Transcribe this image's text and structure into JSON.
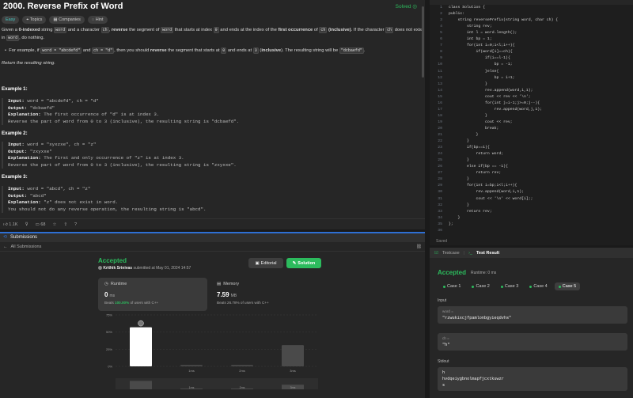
{
  "problem": {
    "title": "2000. Reverse Prefix of Word",
    "status": "Solved",
    "tags": [
      "Easy",
      "Topics",
      "Companies",
      "Hint"
    ],
    "desc_line1": [
      "Given a ",
      "0-indexed",
      " string ",
      "word",
      " and a character ",
      "ch",
      ", ",
      "reverse",
      " the segment of ",
      "word",
      " that starts at index ",
      "0",
      " and ends at the index of the ",
      "first occurrence",
      " of ",
      "ch",
      " (inclusive)",
      ". If the character ",
      "ch",
      " does not exist"
    ],
    "desc_line2": [
      "in ",
      "word",
      ", do nothing."
    ],
    "bullet": [
      "For example, if ",
      "word = \"abcdefd\"",
      " and ",
      "ch = \"d\"",
      ", then you should ",
      "reverse",
      " the segment that starts at ",
      "0",
      " and ends at ",
      "3",
      " (",
      "inclusive",
      "). The resulting string will be ",
      "\"dcbaefd\"",
      "."
    ],
    "return_text": "Return the resulting string.",
    "examples": [
      {
        "title": "Example 1:",
        "input": "word = \"abcdefd\", ch = \"d\"",
        "output": "\"dcbaefd\"",
        "explanation": [
          "The first occurrence of \"d\" is at index 3.",
          "Reverse the part of word from 0 to 3 (inclusive), the resulting string is \"dcbaefd\"."
        ]
      },
      {
        "title": "Example 2:",
        "input": "word = \"xyxzxe\", ch = \"z\"",
        "output": "\"zxyxxe\"",
        "explanation": [
          "The first and only occurrence of \"z\" is at index 3.",
          "Reverse the part of word from 0 to 3 (inclusive), the resulting string is \"zxyxxe\"."
        ]
      },
      {
        "title": "Example 3:",
        "input": "word = \"abcd\", ch = \"z\"",
        "output": "\"abcd\"",
        "explanation": [
          "\"z\" does not exist in word.",
          "You should not do any reverse operation, the resulting string is \"abcd\"."
        ]
      }
    ],
    "labels": {
      "input": "Input:",
      "output": "Output:",
      "explanation": "Explanation:"
    },
    "footer": {
      "likes": "1.1K",
      "comments": "68"
    }
  },
  "submissions": {
    "header_title": "Submissions",
    "sub_header": "All Submissions",
    "result": "Accepted",
    "author": "Krithik Srinivas",
    "submitted_text": "submitted at May 01, 2024 14:57",
    "editorial_label": "Editorial",
    "solution_label": "Solution",
    "runtime": {
      "label": "Runtime",
      "value": "0",
      "unit": "ms",
      "beats_prefix": "Beats",
      "beats_value": "100.00%",
      "beats_suffix": "of users with C++"
    },
    "memory": {
      "label": "Memory",
      "value": "7.59",
      "unit": "MB",
      "beats_prefix": "Beats",
      "beats_value": "26.78%",
      "beats_suffix": "of users with C++"
    }
  },
  "chart_data": {
    "type": "bar",
    "categories": [
      "0ms",
      "1ms",
      "2ms",
      "3ms"
    ],
    "values": [
      57,
      2,
      2,
      31
    ],
    "highlight_index": 0,
    "ylim": [
      0,
      75
    ],
    "yticks": [
      "0%",
      "25%",
      "50%",
      "75%"
    ],
    "x_tick_labels": [
      "1ms",
      "2ms",
      "3ms"
    ],
    "mini_tick_labels": [
      "1ms",
      "2ms",
      "3ms"
    ]
  },
  "editor": {
    "lines": [
      "class Solution {",
      "public:",
      "    string reversePrefix(string word, char ch) {",
      "        string rev;",
      "        int l = word.length();",
      "        int bp = 1;",
      "        for(int i=0;i<l;i++){",
      "            if(word[i]==ch){",
      "                if(i==l-1){",
      "                    bp = -1;",
      "                }else{",
      "                    bp = i+1;",
      "                }",
      "                rev.append(word,i,1);",
      "                cout << rev << '\\n';",
      "                for(int j=i-1;j>=0;j--){",
      "                    rev.append(word,j,1);",
      "                }",
      "                cout << rev;",
      "                break;",
      "            }",
      "        }",
      "        if(bp==1){",
      "            return word;",
      "        }",
      "        else if(bp == -1){",
      "            return rev;",
      "        }",
      "        for(int i=bp;i<l;i++){",
      "            rev.append(word,i,1);",
      "            cout << '\\n' << word[i];;",
      "        }",
      "        return rev;",
      "    }",
      "};",
      ""
    ],
    "status": "Saved"
  },
  "testcase": {
    "tab_testcase": "Testcase",
    "tab_result": "Test Result",
    "result": "Accepted",
    "runtime_text": "Runtime: 0 ms",
    "cases": [
      "Case 1",
      "Case 2",
      "Case 3",
      "Case 4",
      "Case 5"
    ],
    "active_case": 4,
    "input_label": "Input",
    "word_key": "word =",
    "word_value": "\"rzwukixcjfpamlonbgyieqdvhs\"",
    "ch_key": "ch =",
    "ch_value": "\"h\"",
    "stdout_label": "Stdout",
    "stdout_lines": [
      "h",
      "hvdqeiygbnolmapfjcxtkuwzr",
      "s"
    ]
  },
  "colors": {
    "accent_green": "#2cbb5d",
    "easy_teal": "#46c6c2",
    "blue": "#2e6fd4"
  }
}
